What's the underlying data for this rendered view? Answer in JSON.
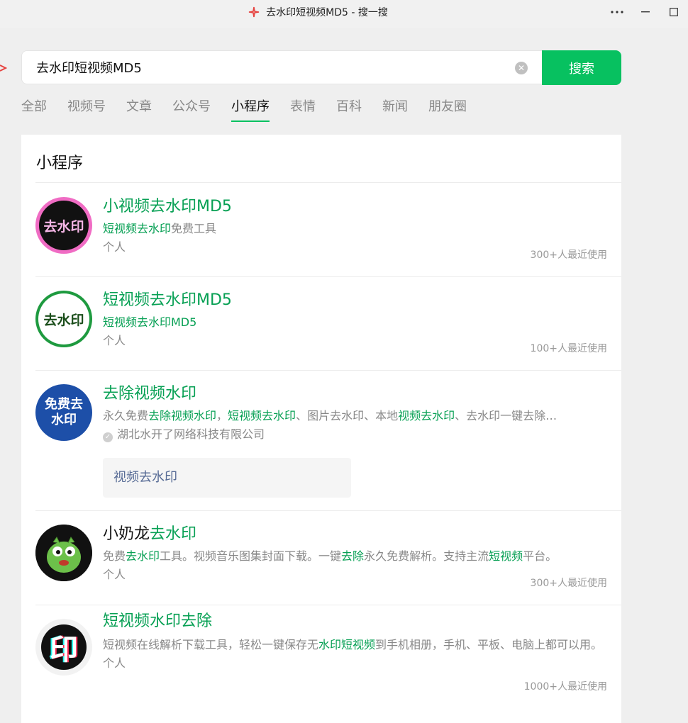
{
  "window": {
    "title": "去水印短视频MD5 - 搜一搜",
    "controls": [
      "more-icon",
      "minimize-icon",
      "maximize-icon"
    ]
  },
  "search": {
    "query": "去水印短视频MD5",
    "button_label": "搜索"
  },
  "tabs": [
    {
      "label": "全部"
    },
    {
      "label": "视频号"
    },
    {
      "label": "文章"
    },
    {
      "label": "公众号"
    },
    {
      "label": "小程序",
      "active": true
    },
    {
      "label": "表情"
    },
    {
      "label": "百科"
    },
    {
      "label": "新闻"
    },
    {
      "label": "朋友圈"
    }
  ],
  "section": {
    "title": "小程序"
  },
  "results": [
    {
      "avatar_text": "去水印",
      "title_parts": [
        {
          "t": "小视频去水印MD5",
          "hl": true
        }
      ],
      "desc_parts": [
        {
          "t": "短视频去水印",
          "hl": true
        },
        {
          "t": "免费工具",
          "hl": false
        }
      ],
      "meta": "个人",
      "usage": "300+人最近使用"
    },
    {
      "avatar_text": "去水印",
      "title_parts": [
        {
          "t": "短视频去水印MD5",
          "hl": true
        }
      ],
      "desc_parts": [
        {
          "t": "短视频去水印MD5",
          "hl": true
        }
      ],
      "meta": "个人",
      "usage": "100+人最近使用"
    },
    {
      "avatar_text": "免费去水印",
      "title_parts": [
        {
          "t": "去除视频水印",
          "hl": true
        }
      ],
      "desc_parts": [
        {
          "t": "永久免费",
          "hl": false
        },
        {
          "t": "去除视频水印",
          "hl": true
        },
        {
          "t": "，",
          "hl": false
        },
        {
          "t": "短视频去水印",
          "hl": true
        },
        {
          "t": "、图片去水印、本地",
          "hl": false
        },
        {
          "t": "视频去水印",
          "hl": true
        },
        {
          "t": "、去水印一键去除…",
          "hl": false
        }
      ],
      "meta": "湖北水开了网络科技有限公司",
      "verified": true,
      "sub_link": "视频去水印"
    },
    {
      "avatar_text": "",
      "title_parts": [
        {
          "t": "小奶龙",
          "hl": false
        },
        {
          "t": "去水印",
          "hl": true
        }
      ],
      "desc_parts": [
        {
          "t": "免费",
          "hl": false
        },
        {
          "t": "去水印",
          "hl": true
        },
        {
          "t": "工具。视频音乐图集封面下载。一键",
          "hl": false
        },
        {
          "t": "去除",
          "hl": true
        },
        {
          "t": "永久免费解析。支持主流",
          "hl": false
        },
        {
          "t": "短视频",
          "hl": true
        },
        {
          "t": "平台。",
          "hl": false
        }
      ],
      "meta": "个人",
      "usage": "300+人最近使用"
    },
    {
      "avatar_text": "印",
      "title_parts": [
        {
          "t": "短视频水印去除",
          "hl": true
        }
      ],
      "desc_parts": [
        {
          "t": "短视频在线解析下载工具，轻松一键保存无",
          "hl": false
        },
        {
          "t": "水印短视频",
          "hl": true
        },
        {
          "t": "到手机相册，手机、平板、电脑上都可以用。",
          "hl": false
        }
      ],
      "meta": "个人",
      "usage": "1000+人最近使用"
    }
  ]
}
